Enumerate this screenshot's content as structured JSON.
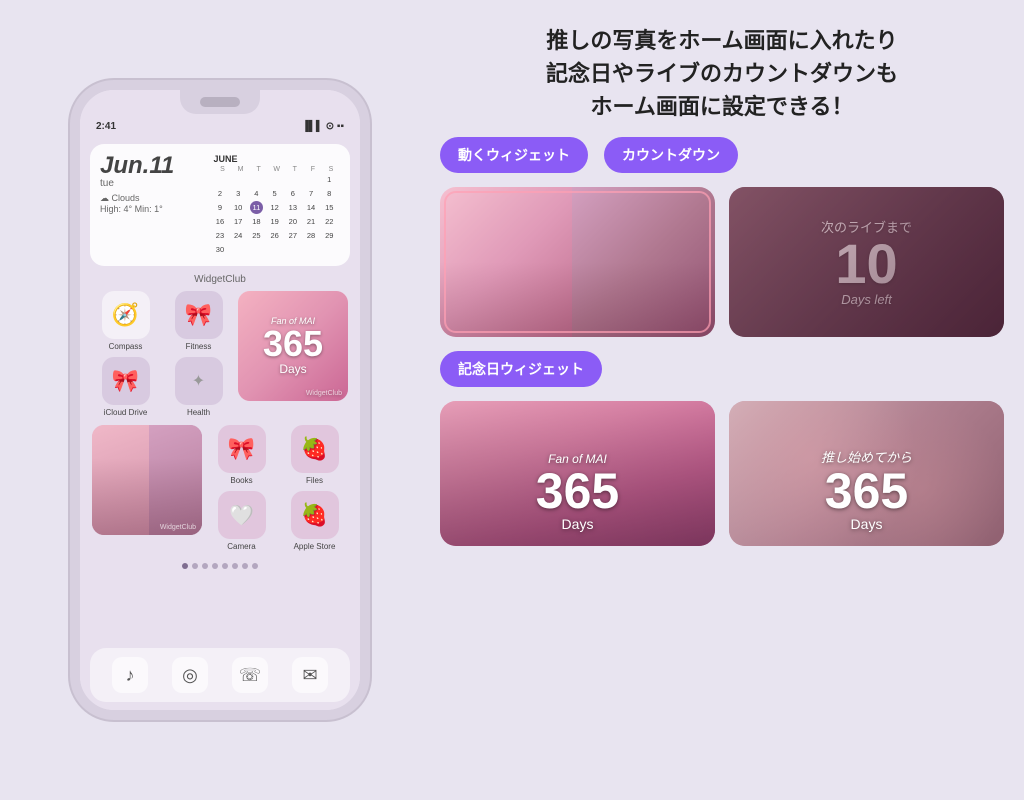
{
  "page": {
    "background_color": "#e8e4f0"
  },
  "phone": {
    "status": {
      "time": "2:41",
      "signal": "●●●",
      "wifi": "wifi",
      "battery": "battery"
    },
    "widget_club_label": "WidgetClub",
    "calendar": {
      "date_big": "Jun.11",
      "day": "tue",
      "weather": "☁ Clouds",
      "temp": "High: 4° Min: 1°",
      "month": "JUNE",
      "days_header": [
        "S",
        "M",
        "T",
        "W",
        "T",
        "F",
        "S"
      ],
      "rows": [
        [
          "",
          "",
          "",
          "",
          "",
          "",
          "1"
        ],
        [
          "2",
          "3",
          "4",
          "5",
          "6",
          "7",
          "8"
        ],
        [
          "9",
          "10",
          "11",
          "12",
          "13",
          "14",
          "15"
        ],
        [
          "16",
          "17",
          "18",
          "19",
          "20",
          "21",
          "22"
        ],
        [
          "23",
          "24",
          "25",
          "26",
          "27",
          "28",
          "29"
        ],
        [
          "30",
          "",
          "",
          "",
          "",
          "",
          ""
        ]
      ],
      "today": "11"
    },
    "app_icons": {
      "row1": [
        {
          "label": "Compass",
          "icon": "🧭"
        },
        {
          "label": "Fitness",
          "icon": "🎀"
        },
        {
          "label": "Fan of MAI",
          "countdown_num": "365",
          "days": "Days",
          "type": "countdown"
        },
        {
          "label": ""
        }
      ],
      "row2": [
        {
          "label": "iCloud Drive",
          "icon": "🎀"
        },
        {
          "label": "Health",
          "icon": "✦"
        },
        {
          "label": "WidgetClub",
          "type": "widgetclub"
        }
      ],
      "row3": [
        {
          "label": "WidgetClub",
          "type": "photo"
        },
        {
          "label": "Books",
          "icon": "🎀"
        },
        {
          "label": "Files",
          "icon": "🍓"
        },
        {
          "label": ""
        }
      ],
      "row4": [
        {
          "label": "",
          "type": "photo2"
        },
        {
          "label": "Camera",
          "icon": "🤍"
        },
        {
          "label": "Apple Store",
          "icon": "🍓"
        }
      ]
    },
    "page_dots": 8,
    "dock": [
      "♪",
      "◎",
      "☏",
      "✉"
    ]
  },
  "right_panel": {
    "hero_title": "推しの写真をホーム画面に入れたり\n記念日やライブのカウントダウンも\nホーム画面に設定できる！",
    "badges": {
      "moving_widget": "動くウィジェット",
      "countdown": "カウントダウン",
      "anniversary": "記念日ウィジェット"
    },
    "moving_widget": {
      "left_caption": "",
      "right_caption": "次のライブまで",
      "right_num": "10",
      "right_days": "Days left"
    },
    "anniversary": {
      "left_title": "Fan of MAI",
      "left_num": "365",
      "left_days": "Days",
      "right_title": "推し始めてから",
      "right_num": "365",
      "right_days": "Days"
    }
  }
}
